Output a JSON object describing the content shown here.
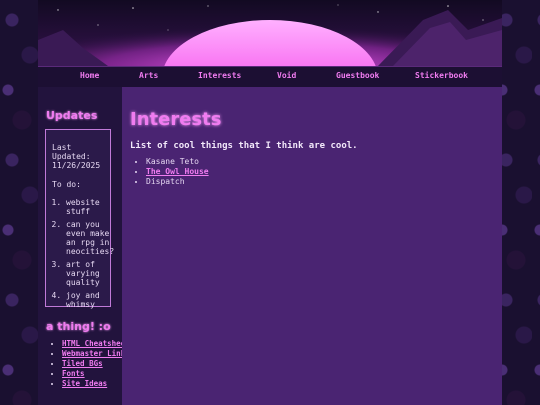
{
  "nav": {
    "items": [
      "Home",
      "Arts",
      "Interests",
      "Void",
      "Guestbook",
      "Stickerbook"
    ]
  },
  "sidebar": {
    "updates_title": "Updates",
    "last_updated": "Last Updated: 11/26/2025",
    "todo_label": "To do:",
    "todo_items": [
      "website stuff",
      "can you even make an rpg in neocities?",
      "art of varying quality",
      "joy and whimsy"
    ],
    "links_title": "a thing! :o",
    "links": [
      "HTML Cheatsheet",
      "Webmaster Links",
      "Tiled BGs",
      "Fonts",
      "Site Ideas"
    ]
  },
  "main": {
    "title": "Interests",
    "intro": "List of cool things that I think are cool.",
    "items": [
      {
        "text": "Kasane Teto",
        "link": false
      },
      {
        "text": "The Owl House",
        "link": true
      },
      {
        "text": "Dispatch",
        "link": false
      }
    ]
  },
  "colors": {
    "accent": "#f07cf0",
    "main_bg": "#4a2472",
    "sidebar_bg": "#22133d",
    "nav_bg": "#1c0f33"
  }
}
